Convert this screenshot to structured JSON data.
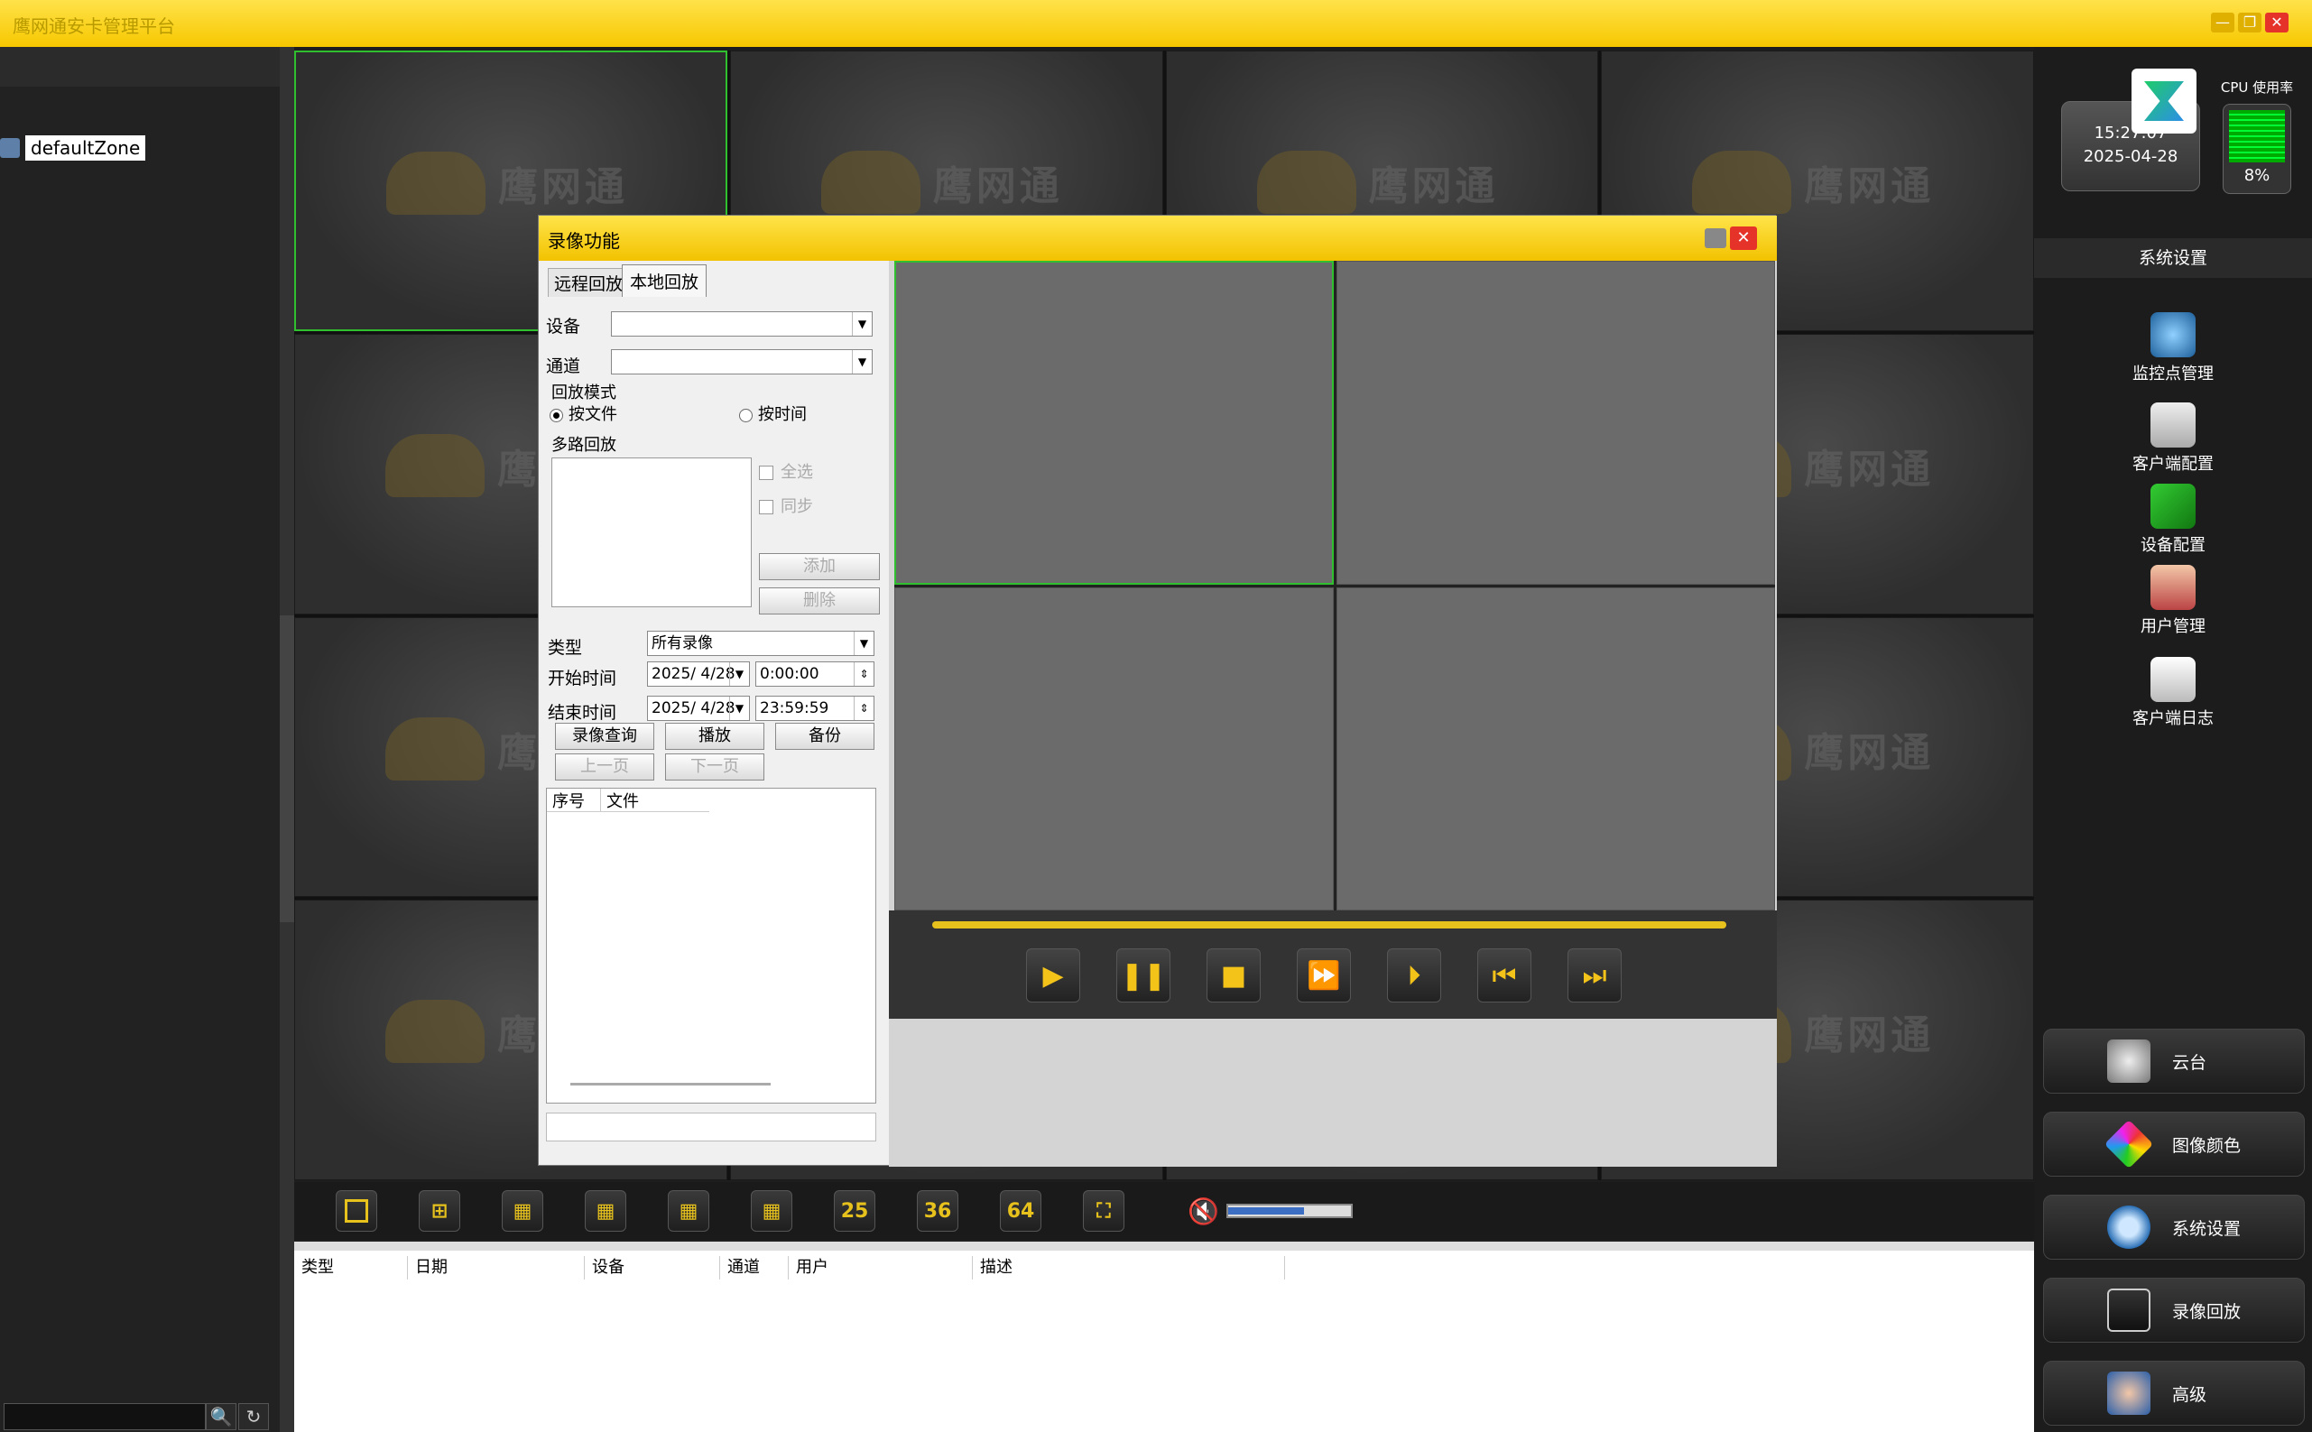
{
  "app": {
    "title": "鹰网通安卡管理平台",
    "minimize": "—",
    "restore": "❐",
    "close": "✕"
  },
  "left_panel": {
    "zone_label": "defaultZone",
    "search_value": "",
    "search_icon": "🔍",
    "refresh_icon": "↻"
  },
  "grid": {
    "watermark": "鹰网通",
    "cells": 16,
    "selected": 0
  },
  "toolbar": {
    "layouts": [
      "1",
      "4",
      "6",
      "9",
      "12",
      "16",
      "25",
      "36",
      "64"
    ],
    "fullscreen_icon": "⛶",
    "volume_icon": "🔇",
    "volume_level": 0.62
  },
  "log": {
    "columns": [
      "类型",
      "日期",
      "设备",
      "通道",
      "用户",
      "描述"
    ]
  },
  "right_panel": {
    "time": "15:27:07",
    "date": "2025-04-28",
    "cpu_label": "CPU 使用率",
    "cpu_percent": "8%",
    "section_title": "系统设置",
    "items": [
      "监控点管理",
      "客户端配置",
      "设备配置",
      "用户管理",
      "客户端日志"
    ],
    "buttons": [
      "云台",
      "图像颜色",
      "系统设置",
      "录像回放",
      "高级"
    ],
    "colors": {
      "accent": "#f7c800",
      "select_green": "#2fbf2f"
    }
  },
  "dialog": {
    "title": "录像功能",
    "tabs": [
      "远程回放",
      "本地回放"
    ],
    "active_tab": 1,
    "device_label": "设备",
    "device_value": "",
    "channel_label": "通道",
    "channel_value": "",
    "mode_group": "回放模式",
    "mode_file": "按文件",
    "mode_time": "按时间",
    "multi_group": "多路回放",
    "select_all": "全选",
    "sync": "同步",
    "add": "添加",
    "delete": "删除",
    "type_label": "类型",
    "type_value": "所有录像",
    "start_label": "开始时间",
    "start_date": "2025/ 4/28",
    "start_time": "0:00:00",
    "end_label": "结束时间",
    "end_date": "2025/ 4/28",
    "end_time": "23:59:59",
    "query": "录像查询",
    "play": "播放",
    "backup": "备份",
    "prev_page": "上一页",
    "next_page": "下一页",
    "col_index": "序号",
    "col_file": "文件",
    "playback_progress": 1.0
  }
}
